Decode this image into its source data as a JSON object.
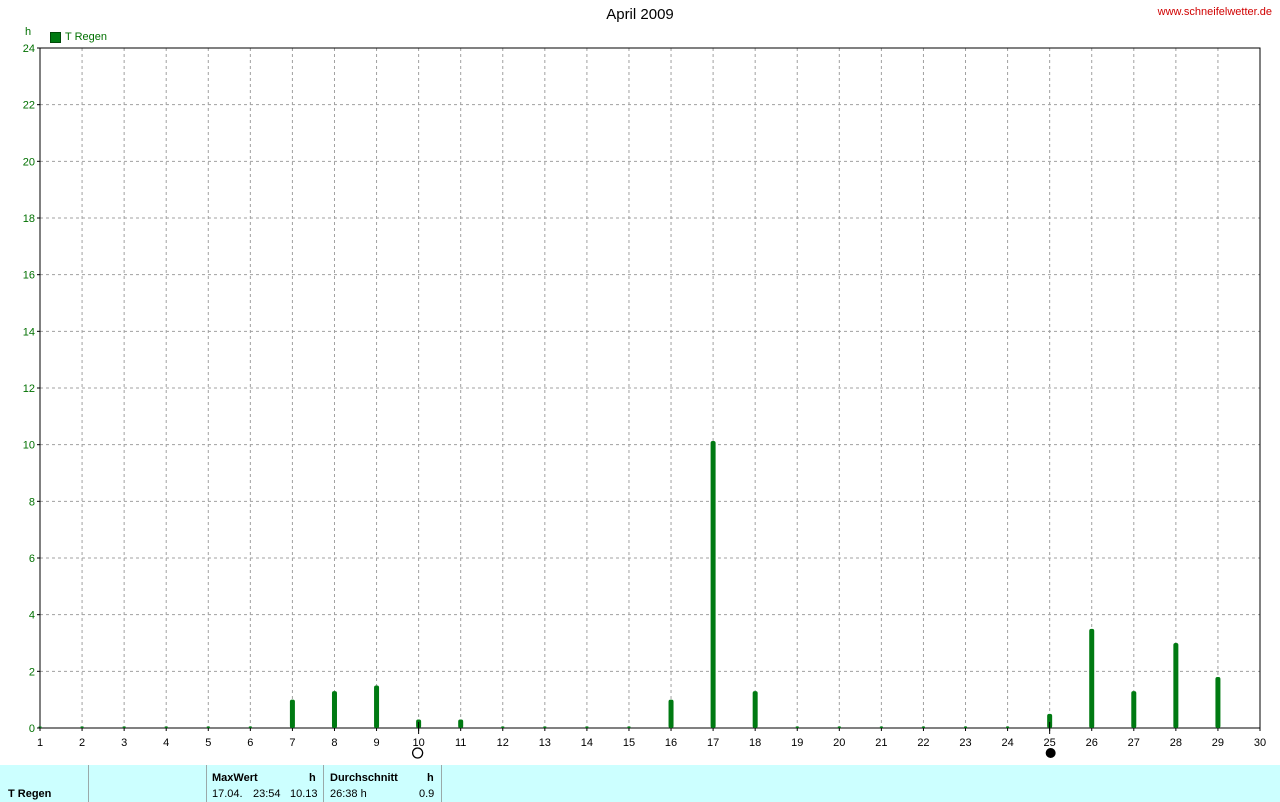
{
  "header": {
    "title": "April 2009",
    "site": "www.schneifelwetter.de",
    "unit": "h",
    "legend_label": "T Regen"
  },
  "colors": {
    "bar": "#007a12",
    "axis_text": "#007000",
    "grid": "#a0a0a0",
    "footer_bg": "#ccffff",
    "site": "#d00000"
  },
  "chart_data": {
    "type": "bar",
    "title": "April 2009",
    "ylabel": "h",
    "xlim": [
      1,
      30
    ],
    "ylim": [
      0,
      24
    ],
    "x_ticks": [
      1,
      2,
      3,
      4,
      5,
      6,
      7,
      8,
      9,
      10,
      11,
      12,
      13,
      14,
      15,
      16,
      17,
      18,
      19,
      20,
      21,
      22,
      23,
      24,
      25,
      26,
      27,
      28,
      29,
      30
    ],
    "y_ticks": [
      0,
      2,
      4,
      6,
      8,
      10,
      12,
      14,
      16,
      18,
      20,
      22,
      24
    ],
    "grid": true,
    "legend_position": "top-left",
    "series": [
      {
        "name": "T Regen",
        "x": [
          1,
          2,
          3,
          4,
          5,
          6,
          7,
          8,
          9,
          10,
          11,
          12,
          13,
          14,
          15,
          16,
          17,
          18,
          19,
          20,
          21,
          22,
          23,
          24,
          25,
          26,
          27,
          28,
          29
        ],
        "values": [
          0,
          0,
          0,
          0,
          0,
          0,
          1.0,
          1.3,
          1.5,
          0.3,
          0.3,
          0,
          0,
          0,
          0,
          1.0,
          10.13,
          1.3,
          0,
          0,
          0,
          0,
          0,
          0,
          0.5,
          3.5,
          1.3,
          3.0,
          1.8
        ]
      }
    ],
    "moon_phases": [
      {
        "x": 10,
        "phase": "full-moon-icon"
      },
      {
        "x": 25,
        "phase": "new-moon-icon"
      }
    ]
  },
  "footer": {
    "series_label": "T Regen",
    "max": {
      "header": "MaxWert",
      "unit": "h",
      "date": "17.04.",
      "time": "23:54",
      "value": "10.13"
    },
    "avg": {
      "header": "Durchschnitt",
      "unit": "h",
      "total": "26:38 h",
      "value": "0.9"
    }
  }
}
